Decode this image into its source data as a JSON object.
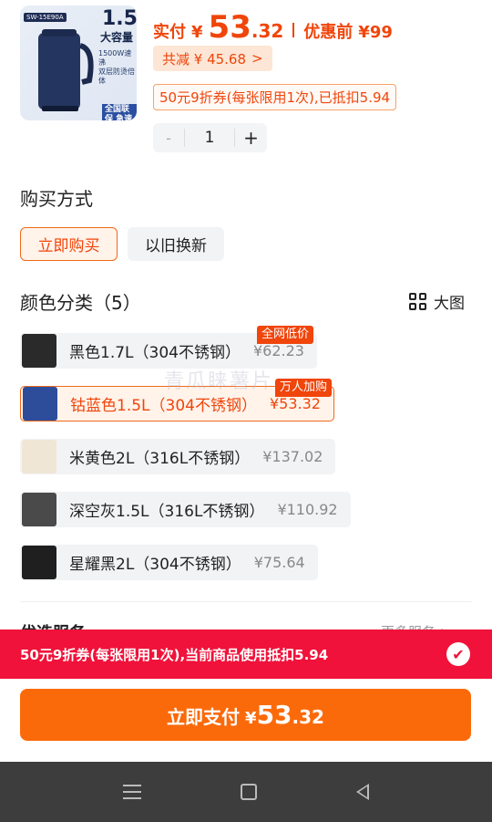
{
  "product": {
    "thumb": {
      "sku": "SW-15E90A",
      "capacity": "1.5L",
      "capacity_label": "大容量",
      "features": [
        "1500W速沸",
        "双层防烫倍体"
      ],
      "service": "全国联保 急速送达"
    },
    "price_label": "实付",
    "currency": "¥",
    "price_int": "53",
    "price_dec": ".32",
    "orig_label": "优惠前",
    "orig_price": "¥99",
    "save_text": "共减 ¥ 45.68",
    "save_arrow": ">",
    "coupon_text": "50元9折券(每张限用1次),已抵扣5.94"
  },
  "stepper": {
    "minus": "-",
    "qty": "1",
    "plus": "+"
  },
  "purchase": {
    "title": "购买方式",
    "options": [
      "立即购买",
      "以旧换新"
    ]
  },
  "colors": {
    "title": "颜色分类（5）",
    "bigview": "大图",
    "items": [
      {
        "name": "黑色1.7L（304不锈钢）",
        "price": "¥62.23",
        "tag": "全网低价",
        "swatch": "#2a2a2a"
      },
      {
        "name": "钴蓝色1.5L（304不锈钢）",
        "price": "¥53.32",
        "tag": "万人加购",
        "swatch": "#2d4d9a"
      },
      {
        "name": "米黄色2L（316L不锈钢）",
        "price": "¥137.02",
        "tag": "",
        "swatch": "#efe6d6"
      },
      {
        "name": "深空灰1.5L（316L不锈钢）",
        "price": "¥110.92",
        "tag": "",
        "swatch": "#4a4a4a"
      },
      {
        "name": "星耀黑2L（304不锈钢）",
        "price": "¥75.64",
        "tag": "",
        "swatch": "#1f1f1f"
      }
    ]
  },
  "watermark": "青瓜睐薯片",
  "peek": {
    "left": "优选服务",
    "right": "更多服务 >"
  },
  "coupon_bar": {
    "text": "50元9折券(每张限用1次),当前商品使用抵扣5.94",
    "check": "✔"
  },
  "pay": {
    "label": "立即支付",
    "currency": "¥",
    "int": "53",
    "dec": ".32"
  },
  "colors_theme": {
    "accent": "#f0450b",
    "bar_red": "#f0123a",
    "button": "#fb6a0a"
  }
}
